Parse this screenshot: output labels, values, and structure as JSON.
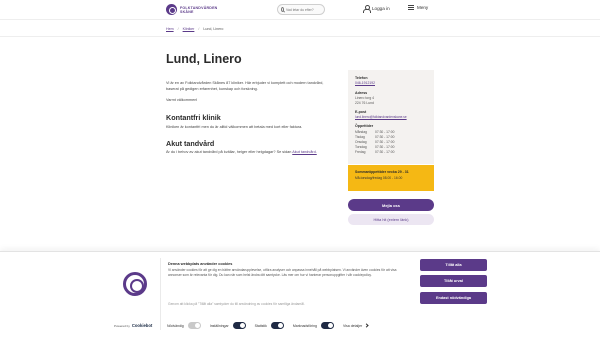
{
  "header": {
    "logo_line1": "FOLKTANDVÅRDEN",
    "logo_line2": "SKÅNE",
    "search_placeholder": "Vad letar du efter?",
    "login_label": "Logga in",
    "menu_label": "Meny"
  },
  "breadcrumb": [
    "Hem",
    "Kliniker",
    "Lund, Linero"
  ],
  "page": {
    "title": "Lund, Linero",
    "intro": "Vi är en av Folktandvården Skånes 87 kliniker. Här erbjuder vi komplett och modern tandvård, baserat på gedigen erfarenhet, kunskap och forskning.",
    "welcome": "Varmt välkommen!",
    "contactless_heading": "Kontantfri klinik",
    "contactless_text": "Kliniken är kontantfri men du är alltid välkommen att betala med kort eller faktura.",
    "acute_heading": "Akut tandvård",
    "acute_text": "Är du i behov av akut tandvård på kvällar, helger eller helgdagar? Se sidan",
    "acute_link": "Akut tandvård."
  },
  "info_card": {
    "phone_label": "Telefon",
    "phone_value": "046-1912192",
    "address_label": "Adress",
    "address_lines": [
      "Linero torg 4",
      "224 76 Lund"
    ],
    "email_label": "E-post",
    "email_value": "lund.linero@folktandvardenskane.se",
    "hours_label": "Öppettider",
    "hours": [
      {
        "day": "Måndag",
        "time": "07:30 - 17:00"
      },
      {
        "day": "Tisdag",
        "time": "07:30 - 17:00"
      },
      {
        "day": "Onsdag",
        "time": "07:30 - 17:00"
      },
      {
        "day": "Torsdag",
        "time": "07:30 - 17:00"
      },
      {
        "day": "Fredag",
        "time": "07:30 - 17:00"
      }
    ]
  },
  "notice": {
    "title": "Sommaröppettider vecka 29 - 31",
    "text": "Må-torsdag/fredag 08.00 - 16.00"
  },
  "buttons": {
    "primary": "Mejla oss",
    "secondary": "Hitta hit (extern länk)"
  },
  "cookie": {
    "title": "Denna webbplats använder cookies",
    "text": "Vi använder cookies för att ge dig en bättre användarupplevelse, utföra analyser och anpassa innehåll på webbplatsen. Vi använder även cookies för att visa annonser som är relevanta för dig. Du kan när som helst ändra ditt samtycke. Läs mer om hur vi hanterar personuppgifter i vår cookiepolicy.",
    "text_faded": "Genom att klicka på \"Tillåt alla\" samtycker du till användning av cookies för samtliga ändamål.",
    "btn_allow_all": "Tillåt alla",
    "btn_allow_selected": "Tillåt urval",
    "btn_necessary": "Endast nödvändiga",
    "powered_by": "Powered by",
    "powered_brand": "Cookiebot",
    "toggles": [
      {
        "label": "Nödvändig",
        "on": true,
        "disabled": true
      },
      {
        "label": "Inställningar",
        "on": true,
        "disabled": false
      },
      {
        "label": "Statistik",
        "on": true,
        "disabled": false
      },
      {
        "label": "Marknadsföring",
        "on": true,
        "disabled": false
      }
    ],
    "details_label": "Visa detaljer"
  },
  "colors": {
    "brand_purple": "#5b3a89",
    "notice_yellow": "#f5b814",
    "card_bg": "#f4f2f0",
    "switch_on": "#1f2a44"
  }
}
